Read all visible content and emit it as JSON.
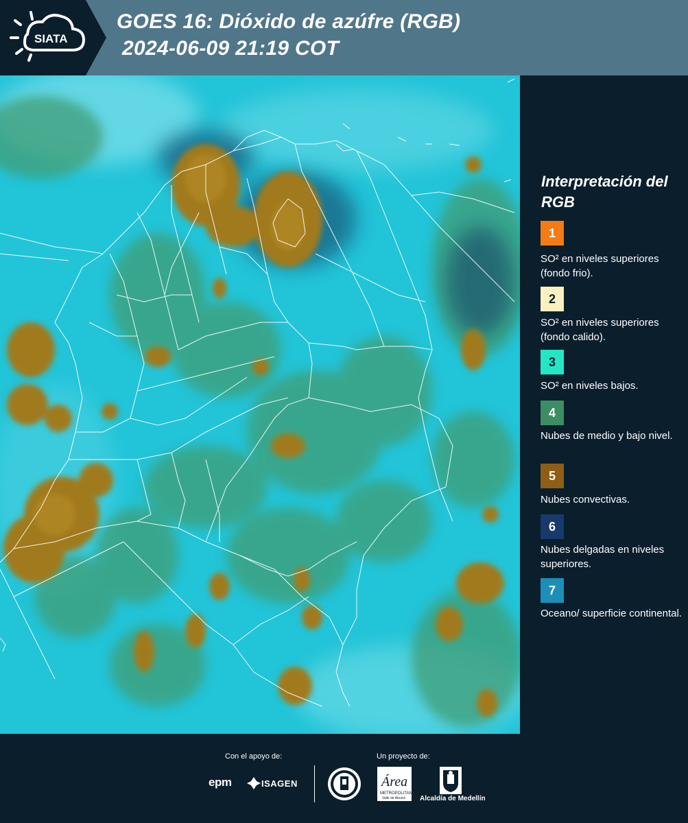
{
  "header": {
    "logo_text": "SIATA",
    "title_line1": "GOES 16: Dióxido de azúfre (RGB)",
    "title_line2": "2024-06-09 21:19 COT"
  },
  "legend": {
    "title": "Interpretación del RGB",
    "items": [
      {
        "number": "1",
        "color": "#f47b15",
        "text": "SO² en niveles superiores (fondo frio)."
      },
      {
        "number": "2",
        "color": "#fbf0bf",
        "text": "SO² en niveles superiores (fondo calido)."
      },
      {
        "number": "3",
        "color": "#25e6c4",
        "text": "SO² en niveles bajos."
      },
      {
        "number": "4",
        "color": "#3d8d64",
        "text": "Nubes de medio y bajo nivel."
      },
      {
        "number": "5",
        "color": "#8f5e14",
        "text": "Nubes convectivas."
      },
      {
        "number": "6",
        "color": "#163a6c",
        "text": "Nubes delgadas en niveles superiores."
      },
      {
        "number": "7",
        "color": "#1b8fb8",
        "text": "Oceano/ superficie continental."
      }
    ]
  },
  "footer": {
    "support_label": "Con el apoyo de:",
    "project_label": "Un proyecto de:",
    "epm_logo": "epm",
    "isagen_logo": "ISAGEN",
    "alcaldia_label": "Alcaldía de Medellín"
  },
  "colors": {
    "background": "#0b1e2c",
    "header": "#50768a",
    "map_base": "#22c4d8",
    "convective": "#a07a1e",
    "low_cloud": "#3f9d74"
  }
}
